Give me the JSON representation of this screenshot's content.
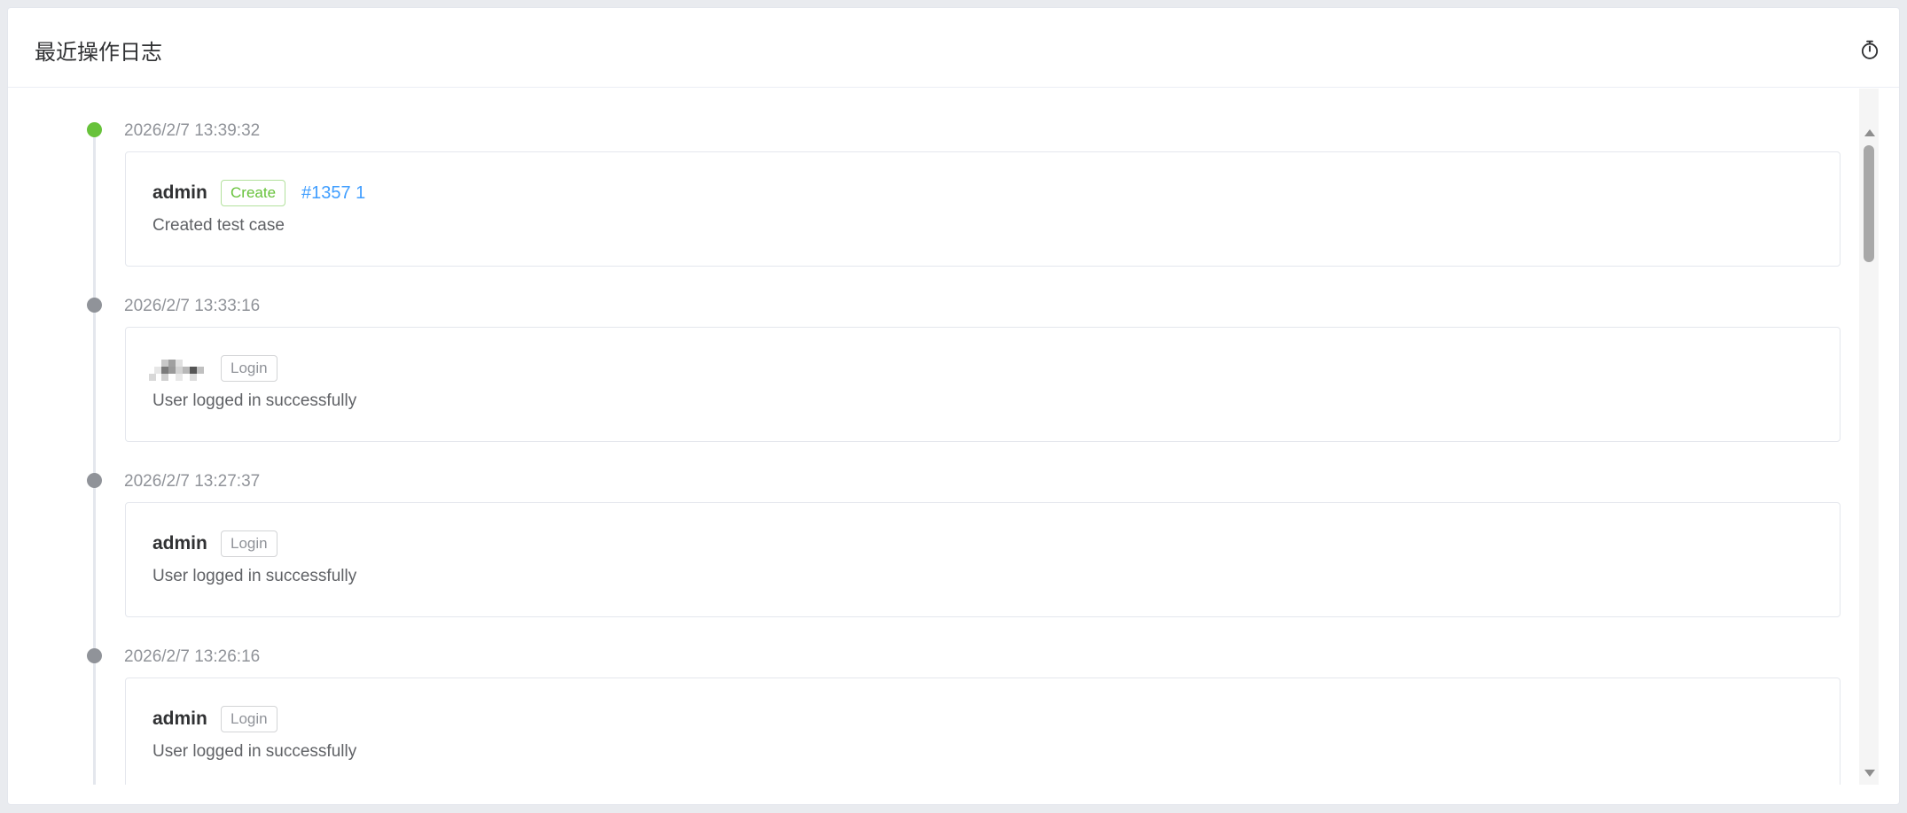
{
  "header": {
    "title": "最近操作日志",
    "icon": "timer-icon"
  },
  "colors": {
    "success": "#67c23a",
    "muted": "#909399",
    "link": "#409eff"
  },
  "logs": [
    {
      "time": "2026/2/7 13:39:32",
      "user": "admin",
      "action": "Create",
      "action_type": "create",
      "link": "#1357 1",
      "description": "Created test case",
      "status": "success"
    },
    {
      "time": "2026/2/7 13:33:16",
      "user": "",
      "user_redacted": true,
      "action": "Login",
      "action_type": "login",
      "description": "User logged in successfully",
      "status": "info"
    },
    {
      "time": "2026/2/7 13:27:37",
      "user": "admin",
      "action": "Login",
      "action_type": "login",
      "description": "User logged in successfully",
      "status": "info"
    },
    {
      "time": "2026/2/7 13:26:16",
      "user": "admin",
      "action": "Login",
      "action_type": "login",
      "description": "User logged in successfully",
      "status": "info"
    }
  ]
}
